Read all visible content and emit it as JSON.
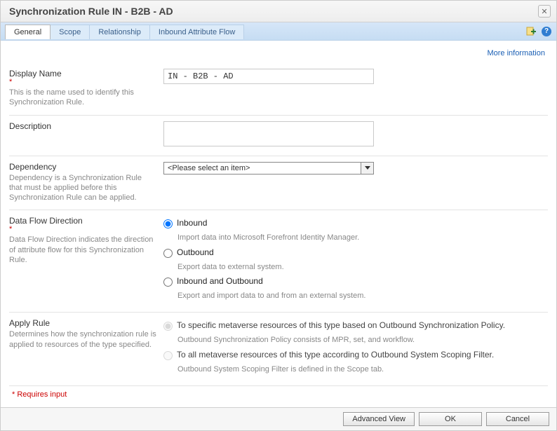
{
  "window": {
    "title": "Synchronization Rule IN - B2B - AD"
  },
  "tabs": [
    {
      "label": "General"
    },
    {
      "label": "Scope"
    },
    {
      "label": "Relationship"
    },
    {
      "label": "Inbound Attribute Flow"
    }
  ],
  "links": {
    "more_info": "More information"
  },
  "form": {
    "display_name": {
      "label": "Display Name",
      "desc": "This is the name used to identify this Synchronization Rule.",
      "value": "IN - B2B - AD"
    },
    "description": {
      "label": "Description",
      "value": ""
    },
    "dependency": {
      "label": "Dependency",
      "desc": "Dependency is a Synchronization Rule that must be applied before this Synchronization Rule can be applied.",
      "placeholder": "<Please select an item>"
    },
    "data_flow": {
      "label": "Data Flow Direction",
      "desc": "Data Flow Direction indicates the direction of attribute flow for this Synchronization Rule.",
      "options": [
        {
          "label": "Inbound",
          "sub": "Import data into Microsoft Forefront Identity Manager."
        },
        {
          "label": "Outbound",
          "sub": "Export data to external system."
        },
        {
          "label": "Inbound and Outbound",
          "sub": "Export and import data to and from an external system."
        }
      ]
    },
    "apply_rule": {
      "label": "Apply Rule",
      "desc": "Determines how the synchronization rule is applied to resources of the type specified.",
      "options": [
        {
          "label": "To specific metaverse resources of this type based on Outbound Synchronization Policy.",
          "sub": "Outbound Synchronization Policy consists of MPR, set, and workflow."
        },
        {
          "label": "To all metaverse resources of this type according to Outbound System Scoping Filter.",
          "sub": "Outbound System Scoping Filter is defined in the Scope tab."
        }
      ]
    },
    "requires_note": "* Requires input"
  },
  "footer": {
    "advanced": "Advanced View",
    "ok": "OK",
    "cancel": "Cancel"
  }
}
